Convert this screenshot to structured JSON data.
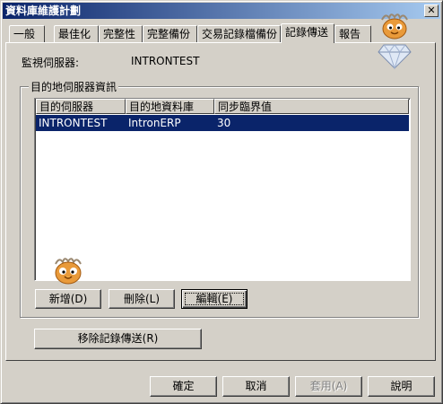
{
  "window": {
    "title": "資料庫維護計劃",
    "close_glyph": "✕"
  },
  "tabs": [
    {
      "label": "一般"
    },
    {
      "label": "最佳化"
    },
    {
      "label": "完整性"
    },
    {
      "label": "完整備份"
    },
    {
      "label": "交易記錄檔備份"
    },
    {
      "label": "記錄傳送",
      "active": true
    },
    {
      "label": "報告"
    }
  ],
  "monitor": {
    "label": "監視伺服器:",
    "value": "INTRONTEST"
  },
  "group": {
    "title": "目的地伺服器資訊"
  },
  "list": {
    "columns": [
      "目的伺服器",
      "目的地資料庫",
      "同步臨界值"
    ],
    "rows": [
      [
        "INTRONTEST",
        "IntronERP",
        "30"
      ]
    ]
  },
  "buttons": {
    "add": "新增(D)",
    "delete": "刪除(L)",
    "edit": "編輯(E)",
    "remove_log_shipping": "移除記錄傳送(R)",
    "ok": "確定",
    "cancel": "取消",
    "apply": "套用(A)",
    "help": "說明"
  },
  "icons": {
    "window_mascot": "penguin-with-diamond-icon",
    "list_mascot": "penguin-head-icon"
  },
  "colors": {
    "selection": "#0a246a",
    "titlebar": "#0a246a"
  }
}
